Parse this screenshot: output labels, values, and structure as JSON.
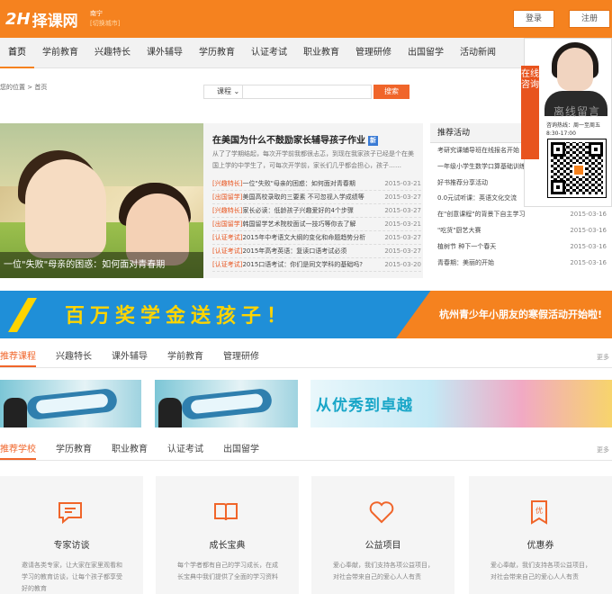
{
  "header": {
    "logo_mark": "2H",
    "logo_text": "择课网",
    "city": "南宁",
    "switch_city": "[切换城市]",
    "login": "登录",
    "register": "注册"
  },
  "nav": [
    "首页",
    "学前教育",
    "兴趣特长",
    "课外辅导",
    "学历教育",
    "认证考试",
    "职业教育",
    "管理研修",
    "出国留学",
    "活动新闻"
  ],
  "breadcrumb": "您的位置 > 首页",
  "search": {
    "category": "课程",
    "placeholder": "",
    "button": "搜索"
  },
  "banner": {
    "caption": "一位\"失败\"母亲的困惑：如何面对青春期"
  },
  "news": {
    "title": "在美国为什么不鼓励家长辅导孩子作业",
    "desc": "从了了学期结起，每次开学前我都很忐忑，到现在我家孩子已经是个在美国上学的中学生了，可每次开学前，家长们几乎都会担心，孩子……",
    "items": [
      {
        "tag": "[兴趣特长]",
        "text": "一位\"失败\"母亲的困惑：如何面对青春期",
        "date": "2015-03-21"
      },
      {
        "tag": "[出国留学]",
        "text": "美国高校录取的三要素 不可忽视入学成绩等",
        "date": "2015-03-27"
      },
      {
        "tag": "[兴趣特长]",
        "text": "家长必读：低龄孩子兴趣爱好的4个步骤",
        "date": "2015-03-27"
      },
      {
        "tag": "[出国留学]",
        "text": "韩国留学艺术院校面试一技巧等你去了解",
        "date": "2015-03-21"
      },
      {
        "tag": "[认证考试]",
        "text": "2015年中考语文大纲的变化和命题趋势分析",
        "date": "2015-03-27"
      },
      {
        "tag": "[认证考试]",
        "text": "2015年高考英语：复读口语考试必须",
        "date": "2015-03-27"
      },
      {
        "tag": "[认证考试]",
        "text": "2015口语考试：你们是同文学科的基础吗?",
        "date": "2015-03-20"
      }
    ]
  },
  "activity": {
    "title": "推荐活动",
    "items": [
      {
        "text": "考研究课辅导班在线报名开始",
        "date": "2015-03-16"
      },
      {
        "text": "一年级小学生数学口算基础训练打卡活动",
        "date": "2015-03-16"
      },
      {
        "text": "好书推荐分享活动",
        "date": "2015-03-16"
      },
      {
        "text": "0.0元试听课：英语文化交流",
        "date": "2015-03-16"
      },
      {
        "text": "在\"创意课程\"的背景下自主学习",
        "date": "2015-03-16"
      },
      {
        "text": "\"吃货\"厨艺大赛",
        "date": "2015-03-16"
      },
      {
        "text": "植树节 种下一个春天",
        "date": "2015-03-16"
      },
      {
        "text": "青春期：美丽的开始",
        "date": "2015-03-16"
      }
    ]
  },
  "float": {
    "label": "在线咨询",
    "offline": "离线留言",
    "phone": "咨询热线：周一至周五 8:30-17:00"
  },
  "ad": {
    "main": "百万奖学金送孩子！",
    "side": "杭州青少年小朋友的寒假活动开始啦!"
  },
  "tabs1": [
    "推荐课程",
    "兴趣特长",
    "课外辅导",
    "学前教育",
    "管理研修"
  ],
  "tabs2": [
    "推荐学校",
    "学历教育",
    "职业教育",
    "认证考试",
    "出国留学"
  ],
  "more": "更多",
  "promo": {
    "text": "从优秀到卓越"
  },
  "cards": [
    {
      "icon": "chat-icon",
      "title": "专家访谈",
      "desc": "邀请各类专家，让大家在家里观看和学习的教育访谈，让每个孩子都享受好的教育"
    },
    {
      "icon": "book-icon",
      "title": "成长宝典",
      "desc": "每个学者都有自己的学习成长，在成长宝典中我们提供了全面的学习资料"
    },
    {
      "icon": "heart-icon",
      "title": "公益项目",
      "desc": "爱心奉献，我们支持各项公益项目，对社会带来自己的爱心人人有责"
    },
    {
      "icon": "coupon-icon",
      "title": "优惠券",
      "desc": "爱心奉献，我们支持各项公益项目，对社会带来自己的爱心人人有责"
    }
  ],
  "colors": {
    "brand": "#f5821f",
    "accent": "#f0652a",
    "ad_blue": "#1f8fd8"
  }
}
